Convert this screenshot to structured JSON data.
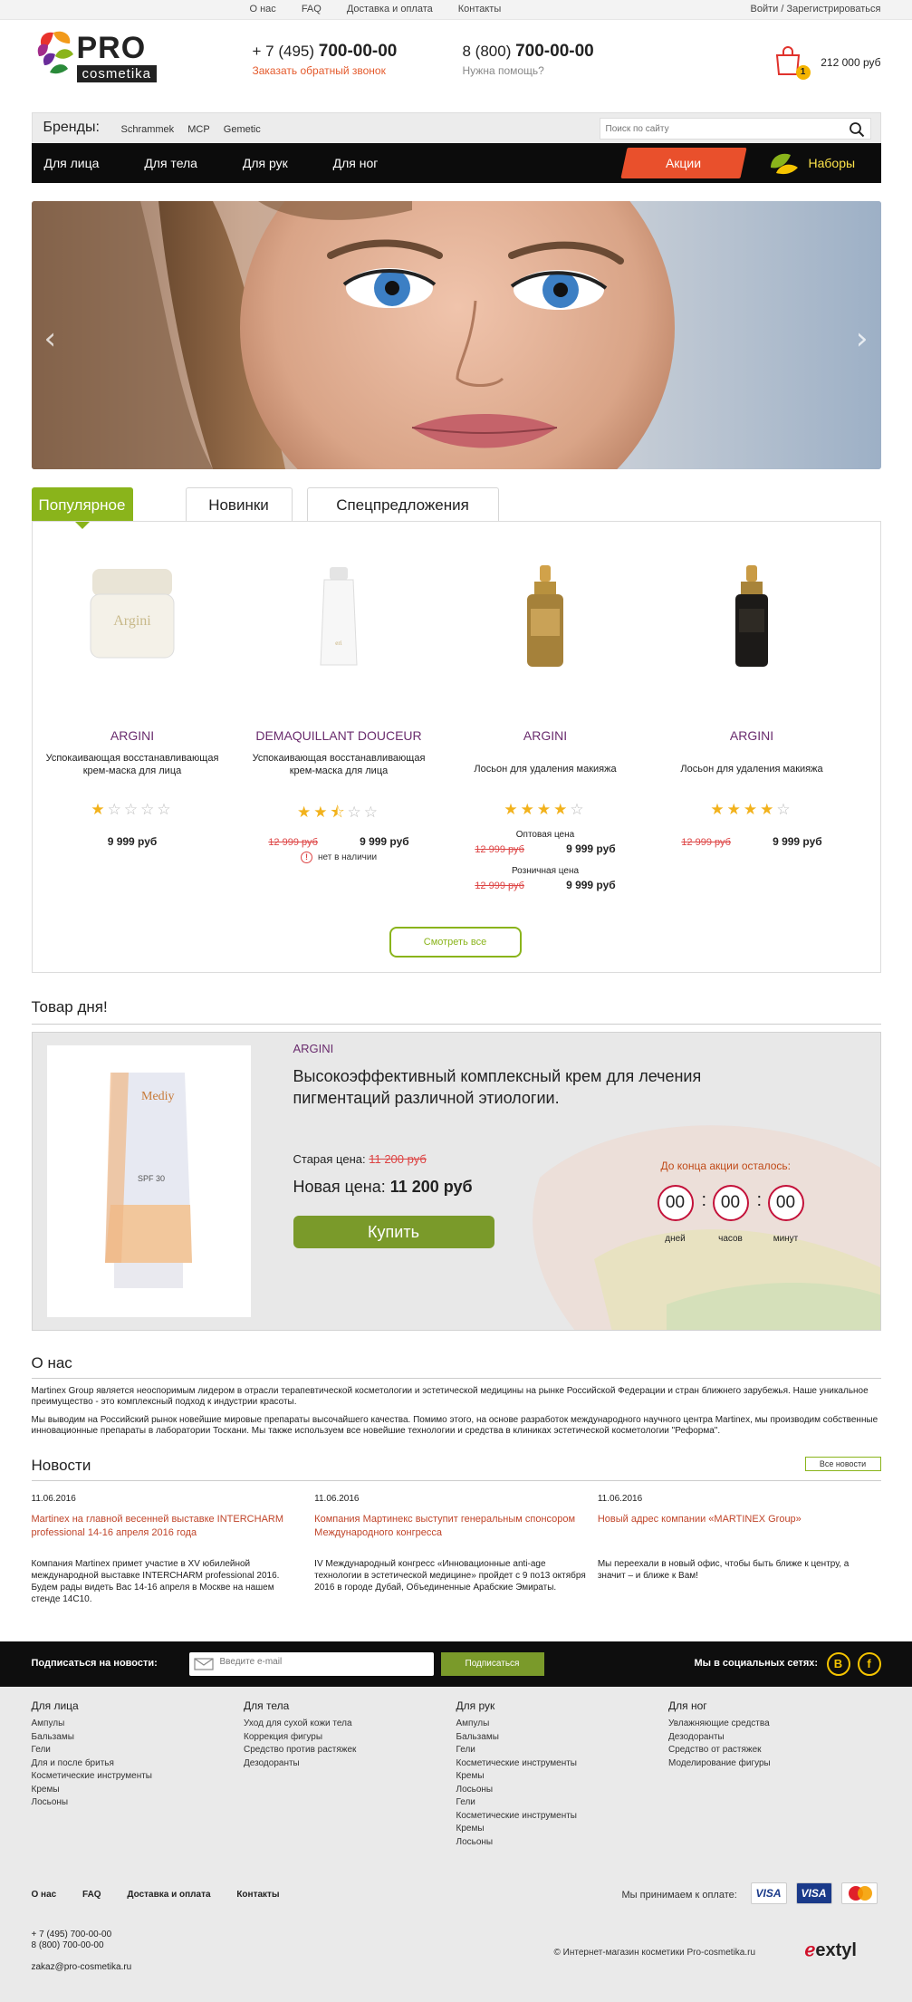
{
  "topbar": {
    "nav": [
      "О нас",
      "FAQ",
      "Доставка и оплата",
      "Контакты"
    ],
    "login": "Войти / Зарегистрироваться"
  },
  "logo": {
    "pro": "PRO",
    "cosmetika": "cosmetika"
  },
  "header": {
    "phone1_prefix": "+ 7 (495)",
    "phone1_number": "700-00-00",
    "callback_link": "Заказать обратный звонок",
    "phone2_prefix": "8 (800)",
    "phone2_number": "700-00-00",
    "help_text": "Нужна помощь?",
    "cart_count": "1",
    "cart_sum": "212 000 руб"
  },
  "brands": {
    "title": "Бренды:",
    "items": [
      "Schrammek",
      "MCP",
      "Gemetic"
    ],
    "search_placeholder": "Поиск по сайту"
  },
  "nav": {
    "items": [
      "Для лица",
      "Для тела",
      "Для рук",
      "Для ног"
    ],
    "promo": "Акции",
    "sets": "Наборы"
  },
  "slider": {
    "prev": "‹",
    "next": "›"
  },
  "tabs": [
    "Популярное",
    "Новинки",
    "Спецпредложения"
  ],
  "products": [
    {
      "brand": "ARGINI",
      "desc": "Успокаивающая восстанавливающая крем-маска для лица",
      "rating": 1,
      "old_price": "",
      "price": "9 999 руб",
      "oos": ""
    },
    {
      "brand": "DEMAQUILLANT DOUCEUR",
      "desc": "Успокаивающая восстанавливающая крем-маска для лица",
      "rating": 2.5,
      "old_price": "12 999 руб",
      "price": "9 999 руб",
      "oos": "нет в наличии"
    },
    {
      "brand": "ARGINI",
      "desc": "Лосьон для удаления макияжа",
      "rating": 4,
      "wholesale_label": "Оптовая цена",
      "wholesale_old": "12 999 руб",
      "wholesale_price": "9 999 руб",
      "retail_label": "Розничная цена",
      "retail_old": "12 999 руб",
      "retail_price": "9 999 руб"
    },
    {
      "brand": "ARGINI",
      "desc": "Лосьон для удаления макияжа",
      "rating": 4,
      "old_price": "12 999 руб",
      "price": "9 999 руб",
      "oos": ""
    }
  ],
  "view_all": "Смотреть все",
  "potd": {
    "title": "Товар дня!",
    "brand": "ARGINI",
    "name": "Высокоэффективный комплексный крем для лечения пигментаций различной этиологии.",
    "old_label": "Старая цена:",
    "old_price": "11 200 руб",
    "new_label": "Новая цена:",
    "new_price": "11 200 руб",
    "buy": "Купить",
    "timer_title": "До конца акции осталось:",
    "days": "00",
    "hours": "00",
    "minutes": "00",
    "days_label": "дней",
    "hours_label": "часов",
    "minutes_label": "минут"
  },
  "about": {
    "title": "О нас",
    "p1": "Martinex Group является неоспоримым лидером в отрасли терапевтической косметологии и эстетической медицины на рынке Российской Федерации и стран ближнего зарубежья. Наше уникальное преимущество - это комплексный подход к индустрии красоты.",
    "p2": "Мы выводим на Российский рынок новейшие мировые препараты высочайшего качества. Помимо этого, на основе разработок международного научного центра Martinex, мы производим собственные инновационные препараты в лаборатории Тоскани. Мы также используем все новейшие технологии и средства в клиниках эстетической косметологии \"Реформа\"."
  },
  "news": {
    "title": "Новости",
    "all": "Все новости",
    "items": [
      {
        "date": "11.06.2016",
        "title": "Martinex на главной весенней выставке INTERCHARM professional 14-16 апреля 2016 года",
        "text": "Компания Martinex примет участие в XV юбилейной международной выставке INTERCHARM professional 2016. Будем рады видеть Вас 14-16 апреля в Москве на нашем стенде 14С10."
      },
      {
        "date": "11.06.2016",
        "title": "Компания Мартинекс выступит генеральным спонсором Международного конгресса",
        "text": "IV Международный конгресс «Инновационные anti-age технологии в эстетической медицине» пройдет с 9 по13 октября 2016 в городе Дубай, Объединенные Арабские Эмираты."
      },
      {
        "date": "11.06.2016",
        "title": "Новый адрес компании «MARTINEX Group»",
        "text": "Мы переехали в новый офис, чтобы быть ближе к центру, а значит – и ближе к Вам!"
      }
    ]
  },
  "subscribe": {
    "label": "Подписаться на новости:",
    "placeholder": "Введите e-mail",
    "button": "Подписаться",
    "social_label": "Мы в социальных сетях:",
    "social1": "В",
    "social2": "f"
  },
  "footer": {
    "cols": [
      {
        "title": "Для лица",
        "items": [
          "Ампулы",
          "Бальзамы",
          "Гели",
          "Для и после бритья",
          "Косметические инструменты",
          "Кремы",
          "Лосьоны"
        ]
      },
      {
        "title": "Для тела",
        "items": [
          "Уход для сухой кожи тела",
          "Коррекция фигуры",
          "Средство против растяжек",
          "Дезодоранты"
        ]
      },
      {
        "title": "Для рук",
        "items": [
          "Ампулы",
          "Бальзамы",
          "Гели",
          "Косметические инструменты",
          "Кремы",
          "Лосьоны",
          "Гели",
          "Косметические инструменты",
          "Кремы",
          "Лосьоны"
        ]
      },
      {
        "title": "Для ног",
        "items": [
          "Увлажняющие средства",
          "Дезодоранты",
          "Средство от растяжек",
          "Моделирование фигуры"
        ]
      }
    ],
    "links": [
      "О нас",
      "FAQ",
      "Доставка и оплата",
      "Контакты"
    ],
    "pay_label": "Мы принимаем к оплате:",
    "cards": [
      "VISA",
      "VISA",
      "MC"
    ],
    "phone1": "+ 7 (495) 700-00-00",
    "phone2": "8 (800) 700-00-00",
    "email": "zakaz@pro-cosmetika.ru",
    "copyright": "© Интернет-магазин косметики Pro-cosmetika.ru",
    "dev": "extyl"
  }
}
